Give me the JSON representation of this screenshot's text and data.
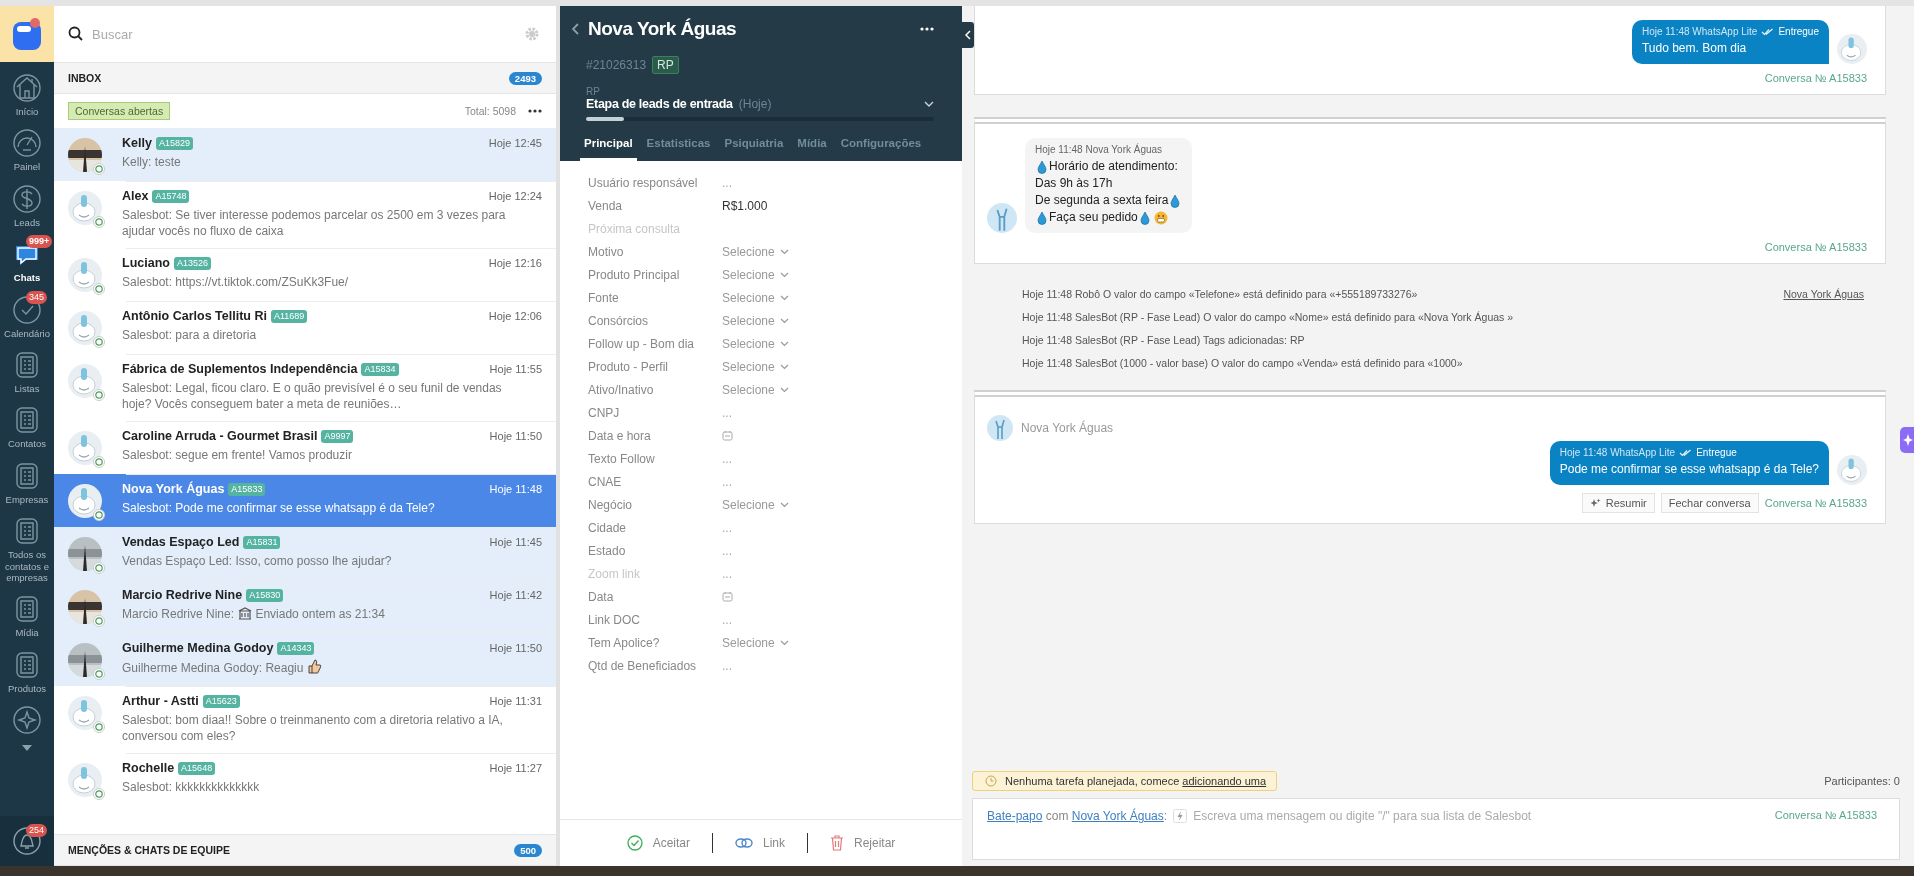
{
  "nav": {
    "items": [
      {
        "label": "Início",
        "selected": false
      },
      {
        "label": "Painel",
        "selected": false
      },
      {
        "label": "Leads",
        "selected": false
      },
      {
        "label": "Chats",
        "selected": true,
        "badge": "999+"
      },
      {
        "label": "Calendário",
        "selected": false,
        "badge": "345"
      },
      {
        "label": "Listas",
        "selected": false
      },
      {
        "label": "Contatos",
        "selected": false
      },
      {
        "label": "Empresas",
        "selected": false
      },
      {
        "label": "Todos os contatos e empresas",
        "selected": false
      },
      {
        "label": "Mídia",
        "selected": false
      },
      {
        "label": "Produtos",
        "selected": false
      },
      {
        "selected": false
      }
    ],
    "bell": {
      "badge": "254"
    }
  },
  "chat_list": {
    "search": {
      "placeholder": "Buscar"
    },
    "inbox": {
      "title": "INBOX",
      "count": "2493"
    },
    "filter": "Conversas abertas",
    "total": "Total: 5098",
    "chats": [
      {
        "name": "Kelly",
        "id": "A15829",
        "time": "Hoje 12:45",
        "preview": "Kelly: teste",
        "selected": false,
        "unread": true
      },
      {
        "name": "Alex",
        "id": "A15748",
        "time": "Hoje 12:24",
        "preview": "Salesbot: Se tiver interesse podemos parcelar os 2500 em 3 vezes para ajudar vocês no fluxo de caixa",
        "kind": "bot",
        "selected": false,
        "unread": false
      },
      {
        "name": "Luciano",
        "id": "A13526",
        "time": "Hoje 12:16",
        "preview": "Salesbot: https://vt.tiktok.com/ZSuKk3Fue/",
        "kind": "bot",
        "selected": false,
        "unread": false
      },
      {
        "name": "Antônio Carlos Tellitu Ri",
        "id": "A11689",
        "time": "Hoje 12:06",
        "preview": "Salesbot: para a diretoria",
        "kind": "bot",
        "selected": false,
        "unread": false
      },
      {
        "name": "Fábrica de Suplementos Independência",
        "id": "A15834",
        "time": "Hoje 11:55",
        "preview": "Salesbot: Legal, ficou claro. E o quão previsível é o seu funil de vendas hoje? Vocês conseguem bater a meta de reuniões…",
        "kind": "bot",
        "selected": false,
        "unread": false
      },
      {
        "name": "Caroline Arruda - Gourmet Brasil",
        "id": "A9997",
        "time": "Hoje 11:50",
        "preview": "Salesbot: segue em frente! Vamos produzir",
        "kind": "bot",
        "selected": false,
        "unread": false
      },
      {
        "name": "Nova York Águas",
        "id": "A15833",
        "time": "Hoje 11:48",
        "preview": "Salesbot: Pode me confirmar se esse whatsapp é da Tele?",
        "kind": "bot",
        "selected": true,
        "unread": false
      },
      {
        "name": "Vendas Espaço Led",
        "id": "A15831",
        "time": "Hoje 11:45",
        "preview": "Vendas Espaço Led: Isso, como posso lhe ajudar?",
        "selected": false,
        "unread": true
      },
      {
        "name": "Marcio Redrive Nine",
        "id": "A15830",
        "time": "Hoje 11:42",
        "preview_parts": [
          {
            "kind": "text",
            "text": "Marcio Redrive Nine:"
          },
          {
            "kind": "building"
          },
          {
            "kind": "text",
            "text": "Enviado ontem as 21:34"
          }
        ],
        "selected": false,
        "unread": true
      },
      {
        "name": "Guilherme Medina Godoy",
        "id": "A14343",
        "time": "Hoje 11:50",
        "preview_parts": [
          {
            "kind": "text",
            "text": "Guilherme Medina Godoy: Reagiu"
          },
          {
            "kind": "thumbs"
          }
        ],
        "selected": false,
        "unread": true
      },
      {
        "name": "Arthur - Astti",
        "id": "A15623",
        "time": "Hoje 11:31",
        "preview": "Salesbot: bom diaa!! Sobre o treinmanento com a diretoria relativo a IA, conversou com eles?",
        "kind": "bot",
        "selected": false,
        "unread": false
      },
      {
        "name": "Rochelle",
        "id": "A15648",
        "time": "Hoje 11:27",
        "preview": "Salesbot: kkkkkkkkkkkkkk",
        "kind": "bot",
        "selected": false,
        "unread": false
      }
    ],
    "footer": {
      "title": "MENÇÕES & CHATS DE EQUIPE",
      "count": "500"
    }
  },
  "lead": {
    "title": "Nova York Águas",
    "number": "#21026313",
    "tag": "RP",
    "pipeline": "RP",
    "stage": "Etapa de leads de entrada",
    "stage_when": "(Hoje)",
    "progress": {
      "level": 0.11
    },
    "tabs": [
      {
        "label": "Principal",
        "selected": true
      },
      {
        "label": "Estatisticas",
        "selected": false
      },
      {
        "label": "Psiquiatria",
        "selected": false
      },
      {
        "label": "Mídia",
        "selected": false
      },
      {
        "label": "Configurações",
        "selected": false
      }
    ],
    "fields": [
      {
        "label": "Usuário responsável",
        "kind": "text",
        "value": "...",
        "muted": false
      },
      {
        "label": "Venda",
        "kind": "amount",
        "value": "R$1.000",
        "muted": false
      },
      {
        "label": "Próxima consulta",
        "kind": "empty",
        "muted": true
      },
      {
        "label": "Motivo",
        "kind": "select",
        "value": "Selecione",
        "muted": false
      },
      {
        "label": "Produto Principal",
        "kind": "select",
        "value": "Selecione",
        "muted": false
      },
      {
        "label": "Fonte",
        "kind": "select",
        "value": "Selecione",
        "muted": false
      },
      {
        "label": "Consórcios",
        "kind": "select",
        "value": "Selecione",
        "muted": false
      },
      {
        "label": "Follow up - Bom dia",
        "kind": "select",
        "value": "Selecione",
        "muted": false
      },
      {
        "label": "Produto - Perfil",
        "kind": "select",
        "value": "Selecione",
        "muted": false
      },
      {
        "label": "Ativo/Inativo",
        "kind": "select",
        "value": "Selecione",
        "muted": false
      },
      {
        "label": "CNPJ",
        "kind": "text",
        "value": "...",
        "muted": false
      },
      {
        "label": "Data e hora",
        "kind": "date",
        "muted": false
      },
      {
        "label": "Texto Follow",
        "kind": "text",
        "value": "...",
        "muted": false
      },
      {
        "label": "CNAE",
        "kind": "text",
        "value": "...",
        "muted": false
      },
      {
        "label": "Negócio",
        "kind": "select",
        "value": "Selecione",
        "muted": false
      },
      {
        "label": "Cidade",
        "kind": "text",
        "value": "...",
        "muted": false
      },
      {
        "label": "Estado",
        "kind": "text",
        "value": "...",
        "muted": false
      },
      {
        "label": "Zoom link",
        "kind": "text",
        "value": "...",
        "muted": true
      },
      {
        "label": "Data",
        "kind": "date",
        "muted": false
      },
      {
        "label": "Link DOC",
        "kind": "text",
        "value": "...",
        "muted": false
      },
      {
        "label": "Tem Apolice?",
        "kind": "select",
        "value": "Selecione",
        "muted": false
      },
      {
        "label": "Qtd de Beneficiados",
        "kind": "text",
        "value": "...",
        "muted": false
      }
    ],
    "actions": [
      {
        "label": "Aceitar",
        "kind": "accept"
      },
      {
        "label": "Link",
        "kind": "link"
      },
      {
        "label": "Rejeitar",
        "kind": "reject"
      }
    ]
  },
  "feed": {
    "blocks": [
      {
        "kind": "card",
        "stacked": false,
        "messages": [
          {
            "kind": "out",
            "meta": "Hoje 11:48 WhatsApp Lite",
            "status": "Entregue",
            "lines": [
              {
                "parts": [
                  {
                    "kind": "text",
                    "text": "Tudo bem. Bom dia"
                  }
                ]
              }
            ]
          }
        ],
        "conversation": "Conversa № A15833"
      },
      {
        "kind": "card",
        "stacked": true,
        "messages": [
          {
            "kind": "in",
            "meta": "Hoje 11:48 Nova York Águas",
            "lines": [
              {
                "parts": [
                  {
                    "kind": "drop"
                  },
                  {
                    "kind": "text",
                    "text": "Horário de atendimento:"
                  }
                ]
              },
              {
                "parts": [
                  {
                    "kind": "text",
                    "text": "Das 9h às 17h"
                  }
                ]
              },
              {
                "parts": [
                  {
                    "kind": "text",
                    "text": "De segunda a sexta feira"
                  },
                  {
                    "kind": "drop"
                  }
                ]
              },
              {
                "parts": [
                  {
                    "kind": "drop"
                  },
                  {
                    "kind": "text",
                    "text": "Faça seu pedido"
                  },
                  {
                    "kind": "drop"
                  },
                  {
                    "kind": "face"
                  }
                ]
              }
            ]
          }
        ],
        "conversation": "Conversa № A15833"
      },
      {
        "kind": "events",
        "events": [
          {
            "text": "Hoje 11:48 Robô O valor do campo «Telefone» está definido para «+555189733276»",
            "link": "Nova York Águas"
          },
          {
            "text": "Hoje 11:48 SalesBot (RP - Fase Lead) O valor do campo «Nome» está definido para «Nova York Águas »"
          },
          {
            "text": "Hoje 11:48 SalesBot (RP - Fase Lead) Tags adicionadas: RP"
          },
          {
            "text": "Hoje 11:48 SalesBot (1000 - valor base) O valor do campo «Venda» está definido para «1000»"
          }
        ]
      },
      {
        "kind": "card",
        "stacked": true,
        "header": "Nova York Águas",
        "messages": [
          {
            "kind": "out",
            "meta": "Hoje 11:48 WhatsApp Lite",
            "status": "Entregue",
            "lines": [
              {
                "parts": [
                  {
                    "kind": "text",
                    "text": "Pode me confirmar se esse whatsapp é da Tele?"
                  }
                ]
              }
            ]
          }
        ],
        "buttons": [
          {
            "label": "Resumir",
            "kind": "ai"
          },
          {
            "label": "Fechar conversa",
            "kind": "plain"
          }
        ],
        "conversation": "Conversa № A15833"
      }
    ],
    "task": {
      "text": "Nenhuma tarefa planejada, comece",
      "link": "adicionando uma"
    },
    "participants": "Participantes: 0",
    "composer": {
      "mode": "Bate-papo",
      "joiner": "com",
      "contact": "Nova York Águas",
      "colon": ":",
      "placeholder": "Escreva uma mensagem ou digite \"/\" para sua lista de Salesbot",
      "conversation": "Conversa № A15833"
    }
  }
}
